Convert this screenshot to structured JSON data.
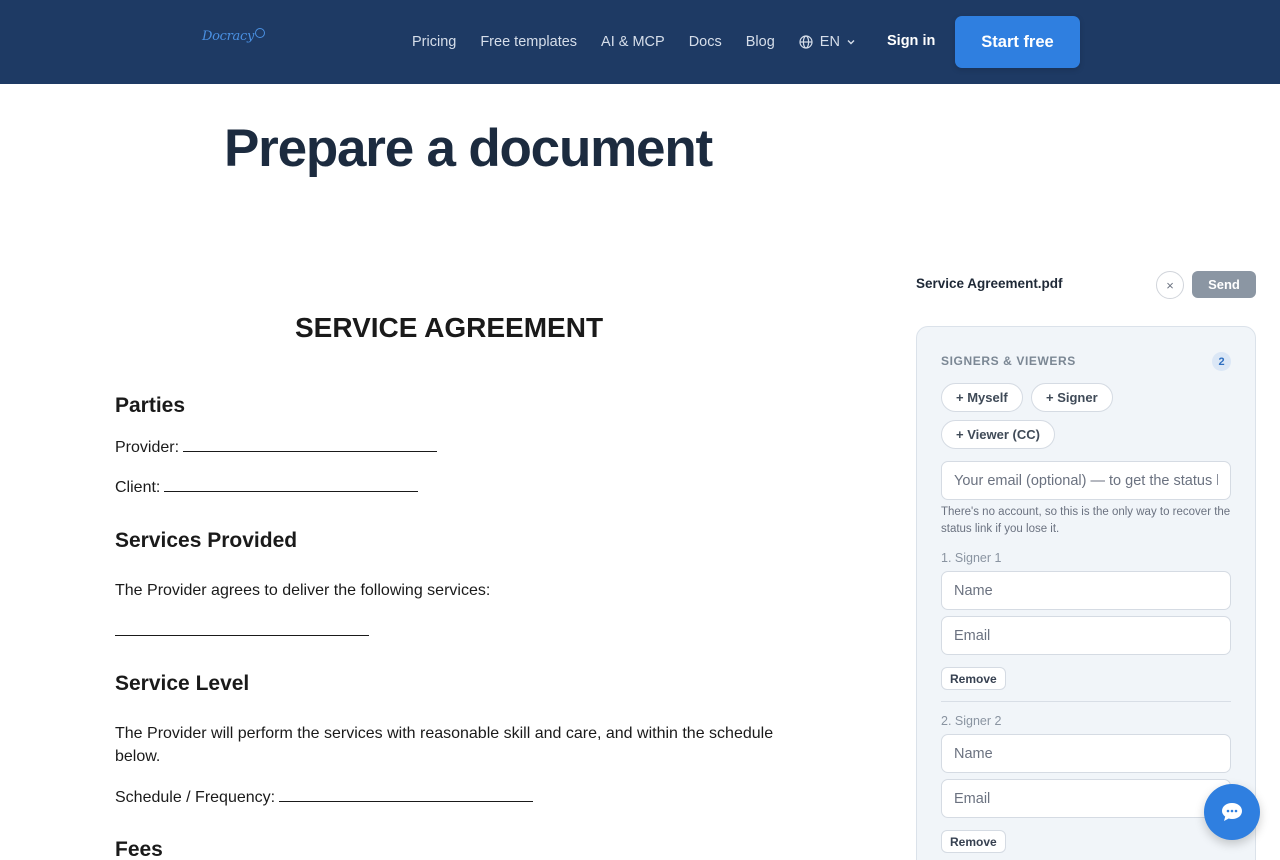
{
  "nav": {
    "logo_text": "Docracy",
    "links": [
      "Pricing",
      "Free templates",
      "AI & MCP",
      "Docs",
      "Blog"
    ],
    "language": "EN",
    "sign_in": "Sign in",
    "start_free": "Start free",
    "colors": {
      "nav_bg": "#1e3a64",
      "accent": "#2f7fe0"
    }
  },
  "page": {
    "title": "Prepare a document"
  },
  "document": {
    "title": "SERVICE AGREEMENT",
    "sections": {
      "parties": {
        "heading": "Parties",
        "provider_label": "Provider:",
        "client_label": "Client:"
      },
      "services": {
        "heading": "Services Provided",
        "text": "The Provider agrees to deliver the following services:"
      },
      "level": {
        "heading": "Service Level",
        "text": "The Provider will perform the services with reasonable skill and care, and within the schedule below.",
        "schedule_label": "Schedule / Frequency:"
      },
      "fees": {
        "heading": "Fees"
      }
    }
  },
  "sidebar": {
    "file_name": "Service Agreement.pdf",
    "close_label": "×",
    "send_label": "Send",
    "heading": "SIGNERS & VIEWERS",
    "count": "2",
    "add_myself": "+ Myself",
    "add_signer": "+ Signer",
    "add_viewer": "+ Viewer (CC)",
    "email_placeholder": "Your email (optional) — to get the status link",
    "hint": "There's no account, so this is the only way to recover the status link if you lose it.",
    "signers": [
      {
        "label": "1. Signer 1",
        "name_placeholder": "Name",
        "email_placeholder": "Email",
        "remove_label": "Remove"
      },
      {
        "label": "2. Signer 2",
        "name_placeholder": "Name",
        "email_placeholder": "Email",
        "remove_label": "Remove"
      }
    ]
  },
  "icons": {
    "globe": "globe-icon",
    "chevron": "chevron-down-icon",
    "chat": "chat-bubble-icon"
  }
}
